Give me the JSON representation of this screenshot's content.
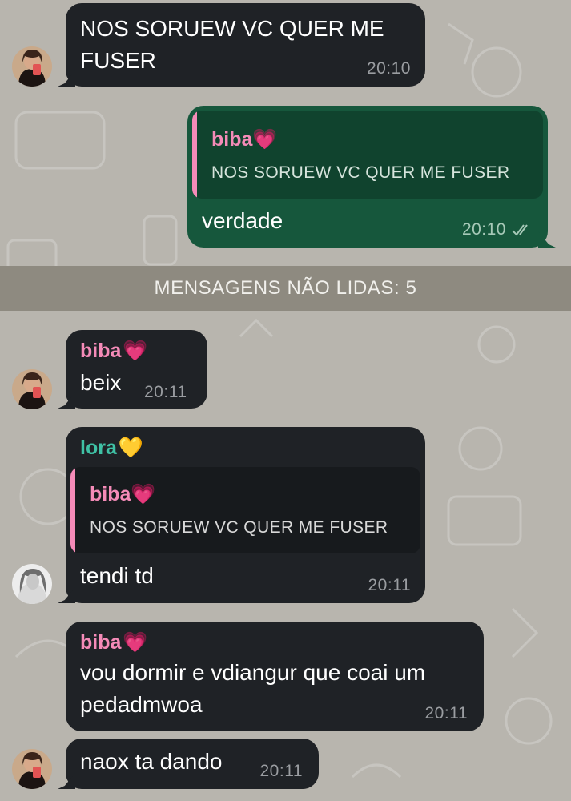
{
  "messages": [
    {
      "id": "m1",
      "direction": "incoming",
      "text": "NOS SORUEW VC QUER ME\nFUSER",
      "time": "20:10"
    },
    {
      "id": "m2",
      "direction": "outgoing",
      "reply": {
        "name": "biba",
        "emoji": "💗",
        "text": "NOS SORUEW VC QUER ME FUSER"
      },
      "text": "verdade",
      "time": "20:10",
      "status": "read-double-check"
    },
    {
      "id": "m3",
      "direction": "incoming",
      "sender": "biba",
      "sender_emoji": "💗",
      "text": "beix",
      "time": "20:11"
    },
    {
      "id": "m4",
      "direction": "incoming",
      "sender": "lora",
      "sender_emoji": "💛",
      "reply": {
        "name": "biba",
        "emoji": "💗",
        "text": "NOS SORUEW VC QUER ME FUSER"
      },
      "text": "tendi td",
      "time": "20:11"
    },
    {
      "id": "m5",
      "direction": "incoming",
      "sender": "biba",
      "sender_emoji": "💗",
      "text": "vou dormir e vdiangur que coai um\npedadmwoa",
      "time": "20:11"
    },
    {
      "id": "m6",
      "direction": "incoming",
      "text": "naox ta dando",
      "time": "20:11"
    }
  ],
  "unread_divider": "MENSAGENS NÃO LIDAS: 5",
  "colors": {
    "background": "#b8b5ae",
    "incoming_bubble": "#1f2226",
    "outgoing_bubble": "#16573c",
    "biba_name": "#f58bb8",
    "lora_name": "#3fc1a5",
    "divider": "#8e8a80"
  },
  "icons": {
    "read_status": "double-check-icon",
    "avatar_biba": "avatar-biba",
    "avatar_lora": "avatar-lora"
  }
}
